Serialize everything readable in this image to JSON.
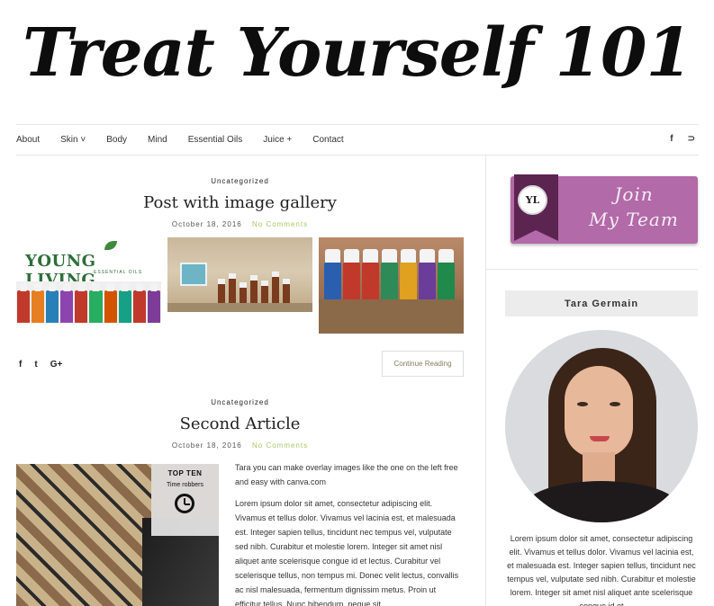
{
  "site": {
    "title": "Treat Yourself 101"
  },
  "nav": {
    "items": [
      {
        "label": "About"
      },
      {
        "label": "Skin ˅"
      },
      {
        "label": "Body"
      },
      {
        "label": "Mind"
      },
      {
        "label": "Essential Oils"
      },
      {
        "label": "Juice +"
      },
      {
        "label": "Contact"
      }
    ],
    "social": {
      "facebook": "f",
      "rss": "⊃"
    }
  },
  "posts": [
    {
      "category": "Uncategorized",
      "title": "Post with image gallery",
      "date": "October 18, 2016",
      "comments": "No Comments",
      "gallery_logo_text": "YOUNG LIVING",
      "gallery_logo_sub": "ESSENTIAL OILS",
      "share": {
        "facebook": "f",
        "twitter": "t",
        "google": "G+"
      },
      "continue_label": "Continue Reading"
    },
    {
      "category": "Uncategorized",
      "title": "Second Article",
      "date": "October 18, 2016",
      "comments": "No Comments",
      "overlay_title": "TOP TEN",
      "overlay_sub": "Time robbers",
      "excerpt_intro": "Tara you can make overlay images like the one on the left free and easy with canva.com",
      "excerpt_body": "Lorem ipsum dolor sit amet, consectetur adipiscing elit. Vivamus et tellus dolor. Vivamus vel lacinia est, et malesuada est. Integer sapien tellus, tincidunt nec tempus vel, vulputate sed nibh. Curabitur et molestie lorem. Integer sit amet nisl aliquet ante scelerisque congue id et lectus. Curabitur vel scelerisque tellus, non tempus mi. Donec velit lectus, convallis ac nisl malesuada, fermentum dignissim metus. Proin ut efficitur tellus. Nunc bibendum, neque sit"
    }
  ],
  "sidebar": {
    "join_badge": "YL",
    "join_text": "Join\nMy Team",
    "author_name": "Tara Germain",
    "bio": "Lorem ipsum dolor sit amet, consectetur adipiscing elit. Vivamus et tellus dolor. Vivamus vel lacinia est, et malesuada est. Integer sapien tellus, tincidunt nec tempus vel, vulputate sed nibh. Curabitur et molestie lorem. Integer sit amet nisl aliquet ante scelerisque congue id et"
  },
  "colors": {
    "accent_green": "#a9c763",
    "join_purple": "#b26aa8",
    "ribbon_purple": "#5c2450"
  }
}
